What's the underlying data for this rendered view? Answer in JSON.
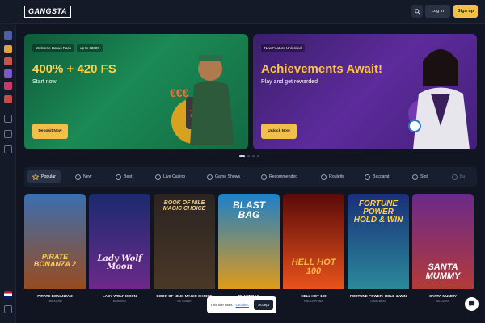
{
  "header": {
    "logo": "GANGSTA",
    "login_label": "Log in",
    "signup_label": "Sign up"
  },
  "banners": [
    {
      "chips": [
        "Welcome Bonus Pack",
        "up to €3300"
      ],
      "title": "400% + 420 FS",
      "subtitle": "Start now",
      "cta": "Deposit Now"
    },
    {
      "chips": [
        "New Feature Unlocked"
      ],
      "title": "Achievements Await!",
      "subtitle": "Play and get rewarded",
      "cta": "Unlock Now"
    }
  ],
  "tabs": [
    {
      "label": "Popular",
      "icon": "star-icon"
    },
    {
      "label": "New",
      "icon": "rocket-icon"
    },
    {
      "label": "Best",
      "icon": "crown-icon"
    },
    {
      "label": "Live Casino",
      "icon": "cards-icon"
    },
    {
      "label": "Game Shows",
      "icon": "tv-icon"
    },
    {
      "label": "Recommended",
      "icon": "thumb-icon"
    },
    {
      "label": "Roulette",
      "icon": "roulette-icon"
    },
    {
      "label": "Baccarat",
      "icon": "chips-icon"
    },
    {
      "label": "Slot",
      "icon": "slot-icon"
    },
    {
      "label": "Bu",
      "icon": "bonus-icon"
    }
  ],
  "games": [
    {
      "name": "PIRATE BONANZA 2",
      "provider": "HACKSAW",
      "art": "PIRATE BONANZA 2",
      "colors": [
        "#3a6fb0",
        "#9a4b1f"
      ]
    },
    {
      "name": "LADY WOLF MOON",
      "provider": "BGAMING",
      "art": "Lady Wolf Moon",
      "colors": [
        "#1b2a6e",
        "#6b2a8a"
      ]
    },
    {
      "name": "BOOK OF NILE: MAGIC CHOICE",
      "provider": "NETGAME",
      "art": "BOOK OF NILE MAGIC CHOICE",
      "colors": [
        "#2a2422",
        "#4a3826"
      ]
    },
    {
      "name": "BLAST BAG",
      "provider": "",
      "art": "BLAST BAG",
      "colors": [
        "#1c80c9",
        "#e09a1a"
      ]
    },
    {
      "name": "HELL HOT 100",
      "provider": "ENDORPHINA",
      "art": "HELL HOT 100",
      "colors": [
        "#5a0a0a",
        "#e8531b"
      ]
    },
    {
      "name": "FORTUNE POWER: HOLD & WIN",
      "provider": "GAMEBEAT",
      "art": "FORTUNE POWER HOLD & WIN",
      "colors": [
        "#1a2f7a",
        "#2a8a9a"
      ]
    },
    {
      "name": "SANTA MUMMY",
      "provider": "BELATRA",
      "art": "SANTA MUMMY",
      "colors": [
        "#6a2a8a",
        "#b33a3a"
      ]
    }
  ],
  "cookie": {
    "text": "This site uses",
    "link": "cookies.",
    "accept": "Accept"
  },
  "colors": {
    "accent": "#f2c04a",
    "background": "#101521"
  }
}
